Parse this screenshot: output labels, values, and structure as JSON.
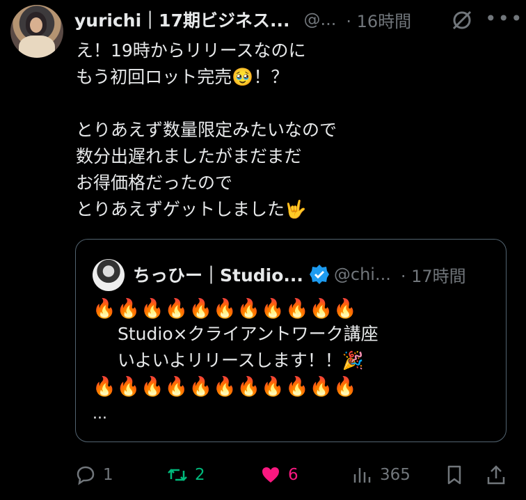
{
  "tweet": {
    "author_name": "yurichi｜17期ビジネス...",
    "handle": "@...",
    "time": "· 16時間",
    "lines": [
      "え！19時からリリースなのに",
      "もう初回ロット完売🥹！？",
      "",
      "とりあえず数量限定みたいなので",
      "数分出遅れましたがまだまだ",
      "お得価格だったので",
      "とりあえずゲットしました🤟"
    ]
  },
  "quote": {
    "author_name": "ちっひー｜Studio...",
    "handle": "@chi...",
    "time": "· 17時間",
    "fire_row_1": "🔥🔥🔥🔥🔥🔥🔥🔥🔥🔥🔥",
    "line_1": "Studio×クライアントワーク講座",
    "line_2": "いよいよリリースします！！🎉",
    "fire_row_2": "🔥🔥🔥🔥🔥🔥🔥🔥🔥🔥🔥",
    "ellipsis": "..."
  },
  "actions": {
    "replies": "1",
    "reposts": "2",
    "likes": "6",
    "views": "365"
  },
  "colors": {
    "background": "#000000",
    "text": "#e7e9ea",
    "muted": "#71767b",
    "repost_green": "#00ba7c",
    "like_pink": "#f91880",
    "verified_blue": "#1d9bf0"
  },
  "icons": [
    "reply-icon",
    "repost-icon",
    "like-icon",
    "views-icon",
    "bookmark-icon",
    "share-icon",
    "grok-icon",
    "more-icon",
    "verified-badge-icon"
  ]
}
